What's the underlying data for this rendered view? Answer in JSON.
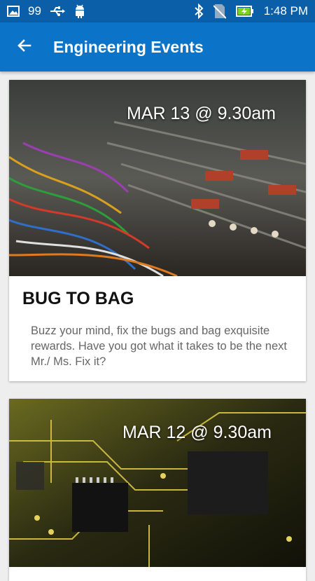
{
  "status_bar": {
    "notification_count": "99",
    "time": "1:48 PM",
    "icons": [
      "image-icon",
      "usb-icon",
      "android-icon",
      "bluetooth-icon",
      "no-sim-icon",
      "battery-charging-icon"
    ]
  },
  "app_bar": {
    "title": "Engineering Events",
    "back_icon": "arrow-left-icon"
  },
  "events": [
    {
      "date": "MAR 13 @ 9.30am",
      "title": "BUG TO BAG",
      "description": "Buzz your mind, fix the bugs and bag exquisite rewards. Have you got what it takes to be the next Mr./ Ms. Fix it?"
    },
    {
      "date": "MAR 12 @ 9.30am"
    }
  ],
  "colors": {
    "status_bar": "#0a5fa8",
    "app_bar": "#0b74c9",
    "background": "#eeeeee"
  }
}
